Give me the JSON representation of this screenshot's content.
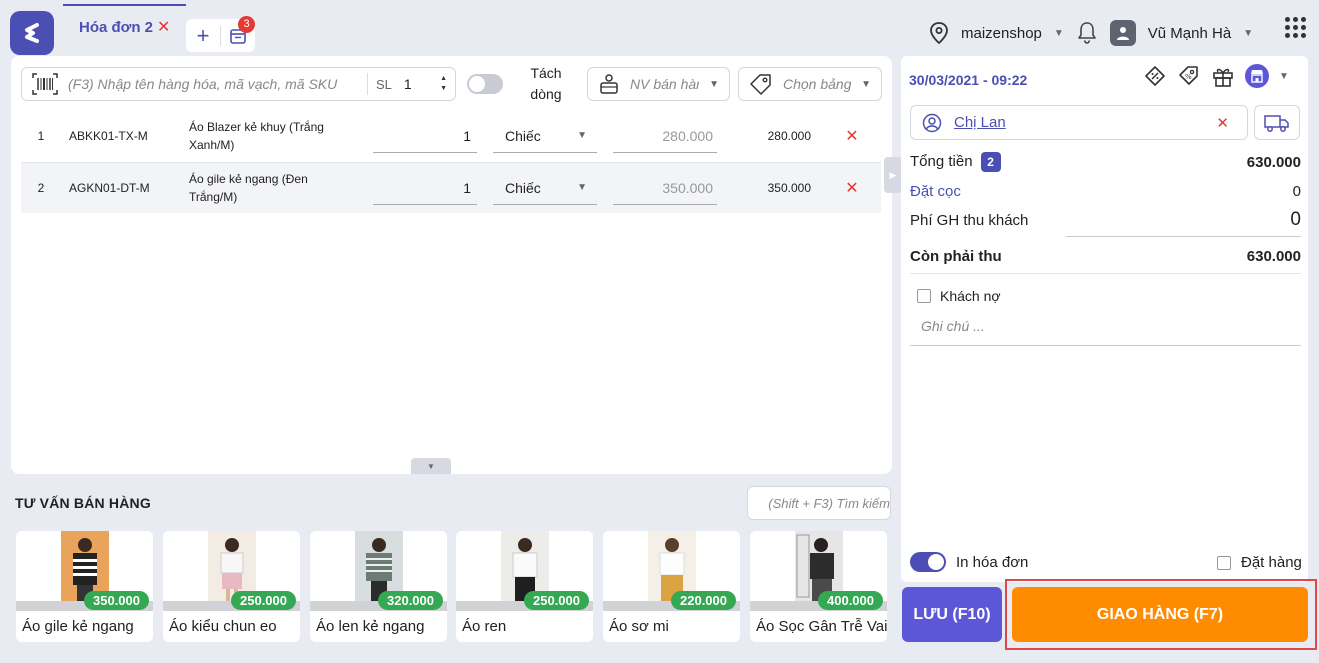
{
  "header": {
    "tab_label": "Hóa đơn 2",
    "tab_close": "✕",
    "add_tab": "+",
    "orders_badge": "3",
    "store_name": "maizenshop",
    "user_name": "Vũ Mạnh Hà"
  },
  "toolbar": {
    "search_placeholder": "(F3) Nhập tên hàng hóa, mã vạch, mã SKU",
    "sl_label": "SL",
    "sl_value": "1",
    "split_label_1": "Tách",
    "split_label_2": "dòng",
    "staff_placeholder": "NV bán hàng",
    "pricebook_placeholder": "Chọn bảng giá"
  },
  "items": [
    {
      "index": "1",
      "code": "ABKK01-TX-M",
      "name": "Áo Blazer kẻ khuy (Trắng Xanh/M)",
      "qty": "1",
      "unit": "Chiếc",
      "price": "280.000",
      "total": "280.000"
    },
    {
      "index": "2",
      "code": "AGKN01-DT-M",
      "name": "Áo gile kẻ ngang (Đen Trắng/M)",
      "qty": "1",
      "unit": "Chiếc",
      "price": "350.000",
      "total": "350.000"
    }
  ],
  "suggest": {
    "title": "TƯ VẤN BÁN HÀNG",
    "search_placeholder": "(Shift + F3) Tìm kiếm",
    "products": [
      {
        "name": "Áo gile kẻ ngang",
        "price": "350.000"
      },
      {
        "name": "Áo kiểu chun eo",
        "price": "250.000"
      },
      {
        "name": "Áo len kẻ ngang",
        "price": "320.000"
      },
      {
        "name": "Áo ren",
        "price": "250.000"
      },
      {
        "name": "Áo sơ mi",
        "price": "220.000"
      },
      {
        "name": "Áo Sọc Gân Trễ Vai",
        "price": "400.000"
      }
    ]
  },
  "order": {
    "datetime": "30/03/2021 - 09:22",
    "customer": "Chị Lan",
    "total_label": "Tổng tiền",
    "total_count": "2",
    "total_value": "630.000",
    "deposit_label": "Đặt cọc",
    "deposit_value": "0",
    "ship_fee_label": "Phí GH thu khách",
    "ship_fee_value": "0",
    "remaining_label": "Còn phải thu",
    "remaining_value": "630.000",
    "debt_label": "Khách nợ",
    "note_placeholder": "Ghi chú ...",
    "print_label": "In hóa đơn",
    "preorder_label": "Đặt hàng",
    "save_button": "LƯU (F10)",
    "deliver_button": "GIAO HÀNG (F7)"
  },
  "colors": {
    "primary": "#4b4fb3",
    "deliver": "#ff8c00",
    "price_badge": "#35a853",
    "danger": "#e53935"
  }
}
